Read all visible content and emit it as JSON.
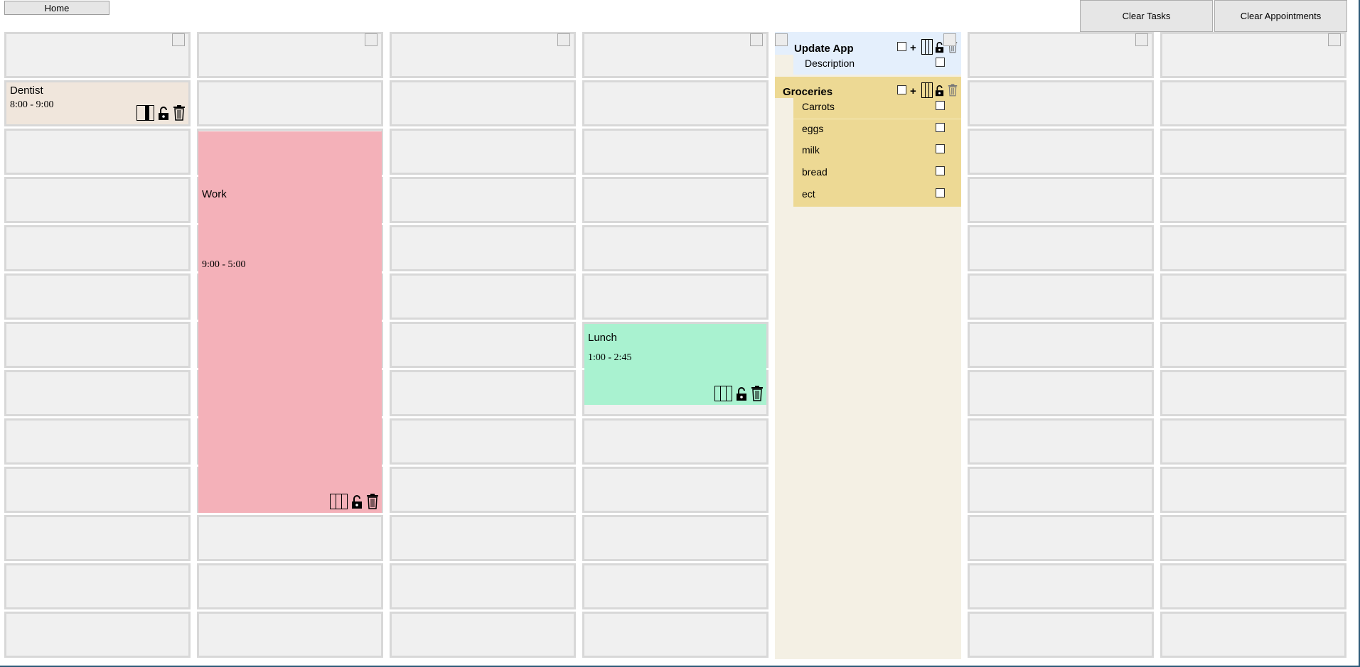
{
  "toolbar": {
    "home_label": "Home",
    "clear_tasks_label": "Clear Tasks",
    "clear_appointments_label": "Clear Appointments"
  },
  "appointments": [
    {
      "title": "Dentist",
      "time": "8:00 - 9:00",
      "color": "#f0e6dc"
    },
    {
      "title": "Work",
      "time": "9:00 - 5:00",
      "color": "#f4b1b9"
    },
    {
      "title": "Lunch",
      "time": "1:00 - 2:45",
      "color": "#a9f2d0"
    }
  ],
  "task_lists": [
    {
      "title": "Update App",
      "color": "#e4effc",
      "items": [
        "Description"
      ]
    },
    {
      "title": "Groceries",
      "color": "#edd994",
      "items": [
        "Carrots",
        "eggs",
        "milk",
        "bread",
        "ect"
      ]
    }
  ],
  "icons": {
    "split": "split-icon",
    "lock": "unlock-icon",
    "trash": "trash-icon"
  }
}
